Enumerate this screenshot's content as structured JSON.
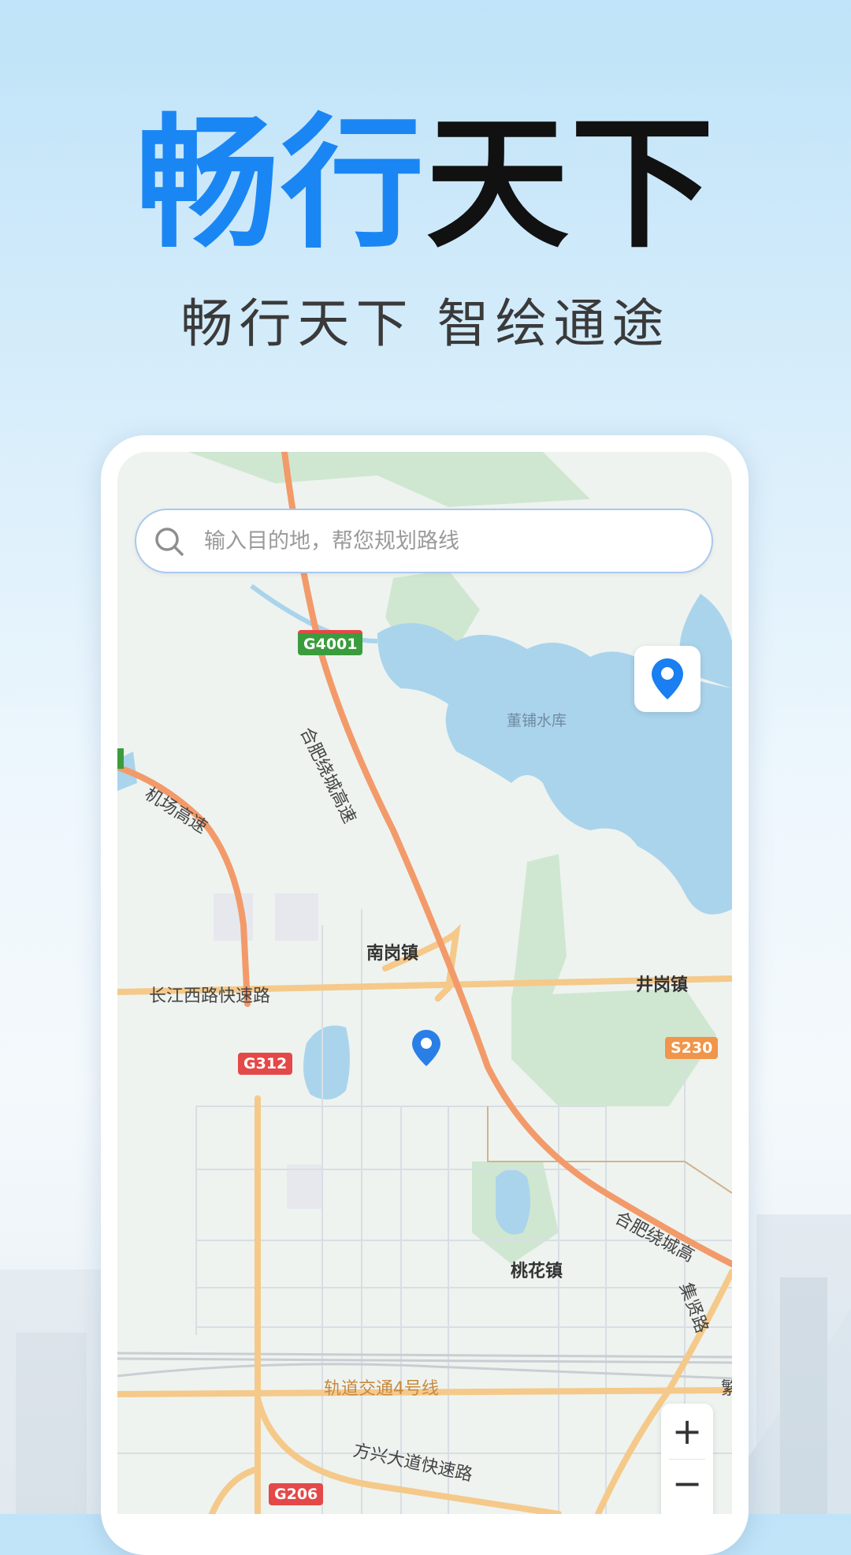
{
  "promo": {
    "title_blue": "畅行",
    "title_black": "天下",
    "subtitle": "畅行天下  智绘通途"
  },
  "search": {
    "placeholder": "输入目的地，帮您规划路线",
    "icon": "search-icon"
  },
  "map": {
    "labels": {
      "reservoir": "董铺水库",
      "town_nangang": "南岗镇",
      "town_jinggang": "井岗镇",
      "town_taohua": "桃花镇",
      "road_airport": "机场高速",
      "road_ring_north": "合肥绕城高速",
      "road_changjiang": "长江西路快速路",
      "road_ring_east": "合肥绕城高",
      "road_jixian": "集贤路",
      "road_fangxing": "方兴大道快速路",
      "rail_line4": "轨道交通4号线",
      "edge_char": "繁"
    },
    "shields": {
      "g4001": "G4001",
      "g312": "G312",
      "s230": "S230",
      "g206": "G206"
    },
    "colors": {
      "expressway": "#f39a6a",
      "arterial": "#f5c98a",
      "water": "#aad4ec",
      "park": "#cfe7d1",
      "shield_green": "#3a9c3c",
      "shield_red": "#e44848",
      "shield_orange": "#f0954a",
      "pin": "#1a7ff0"
    }
  },
  "controls": {
    "locate_icon": "location-pin-icon",
    "zoom_in": "+",
    "zoom_out": "−"
  }
}
